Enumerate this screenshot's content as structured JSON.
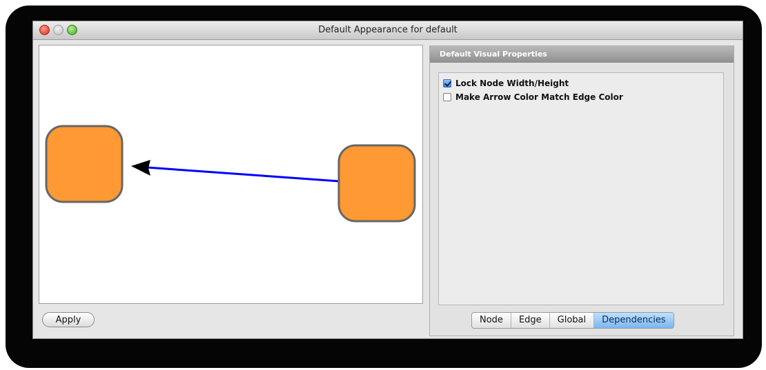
{
  "window": {
    "title": "Default Appearance for default"
  },
  "preview": {
    "node_color": "#FF9933",
    "node_border_color": "#666666",
    "edge_color": "#0000FF",
    "arrow_color": "#000000"
  },
  "buttons": {
    "apply": "Apply"
  },
  "panel": {
    "header": "Default Visual Properties",
    "properties": [
      {
        "label": "Lock Node Width/Height",
        "checked": true
      },
      {
        "label": "Make Arrow Color Match Edge Color",
        "checked": false
      }
    ],
    "tabs": [
      {
        "label": "Node",
        "active": false
      },
      {
        "label": "Edge",
        "active": false
      },
      {
        "label": "Global",
        "active": false
      },
      {
        "label": "Dependencies",
        "active": true
      }
    ]
  }
}
